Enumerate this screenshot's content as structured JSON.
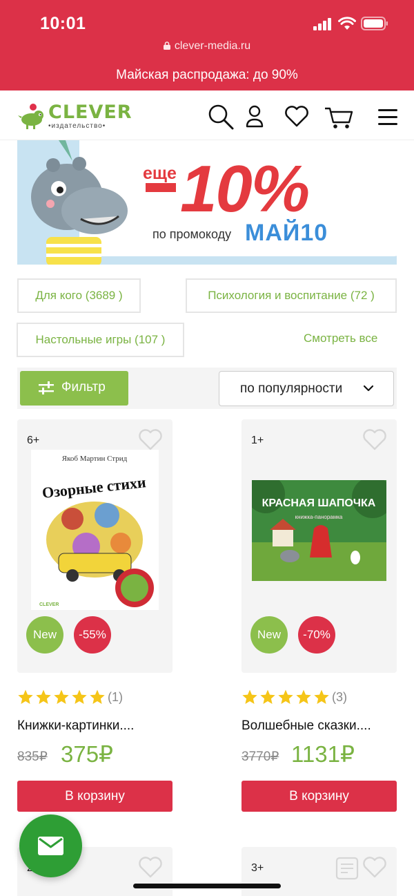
{
  "status": {
    "time": "10:01",
    "url": "clever-media.ru"
  },
  "promo_bar": "Майская распродажа: до 90%",
  "header": {
    "logo_word": "CLEVER",
    "logo_sub": "•издательство•",
    "icons": [
      "search-icon",
      "user-icon",
      "heart-icon",
      "cart-icon",
      "menu-icon"
    ]
  },
  "banner": {
    "eshe": "еще",
    "percent": "10%",
    "code_label": "по промокоду",
    "code": "МАЙ10"
  },
  "categories": [
    {
      "label": "Для кого (3689 )"
    },
    {
      "label": "Психология и воспитание (72 )"
    },
    {
      "label": "Настольные игры (107 )"
    }
  ],
  "see_all": "Смотреть все",
  "filter": {
    "label": "Фильтр",
    "sort_value": "по популярности"
  },
  "products": [
    {
      "age": "6+",
      "cover_title": "Озорные стихи",
      "cover_author": "Якоб Мартин Стрид",
      "badge_new": "New",
      "badge_discount": "-55%",
      "rating_count": "(1)",
      "title": "Книжки-картинки....",
      "old_price": "835₽",
      "price": "375₽",
      "cart_label": "В корзину"
    },
    {
      "age": "1+",
      "cover_title": "КРАСНАЯ ШАПОЧКА",
      "cover_sub": "книжка-панорамка",
      "badge_new": "New",
      "badge_discount": "-70%",
      "rating_count": "(3)",
      "title": "Волшебные сказки....",
      "old_price": "3770₽",
      "price": "1131₽",
      "cart_label": "В корзину"
    }
  ],
  "next_row": [
    {
      "age": "2"
    },
    {
      "age": "3+"
    }
  ],
  "colors": {
    "brand_red": "#dc3148",
    "brand_green": "#7ab342",
    "star": "#f5c518"
  }
}
